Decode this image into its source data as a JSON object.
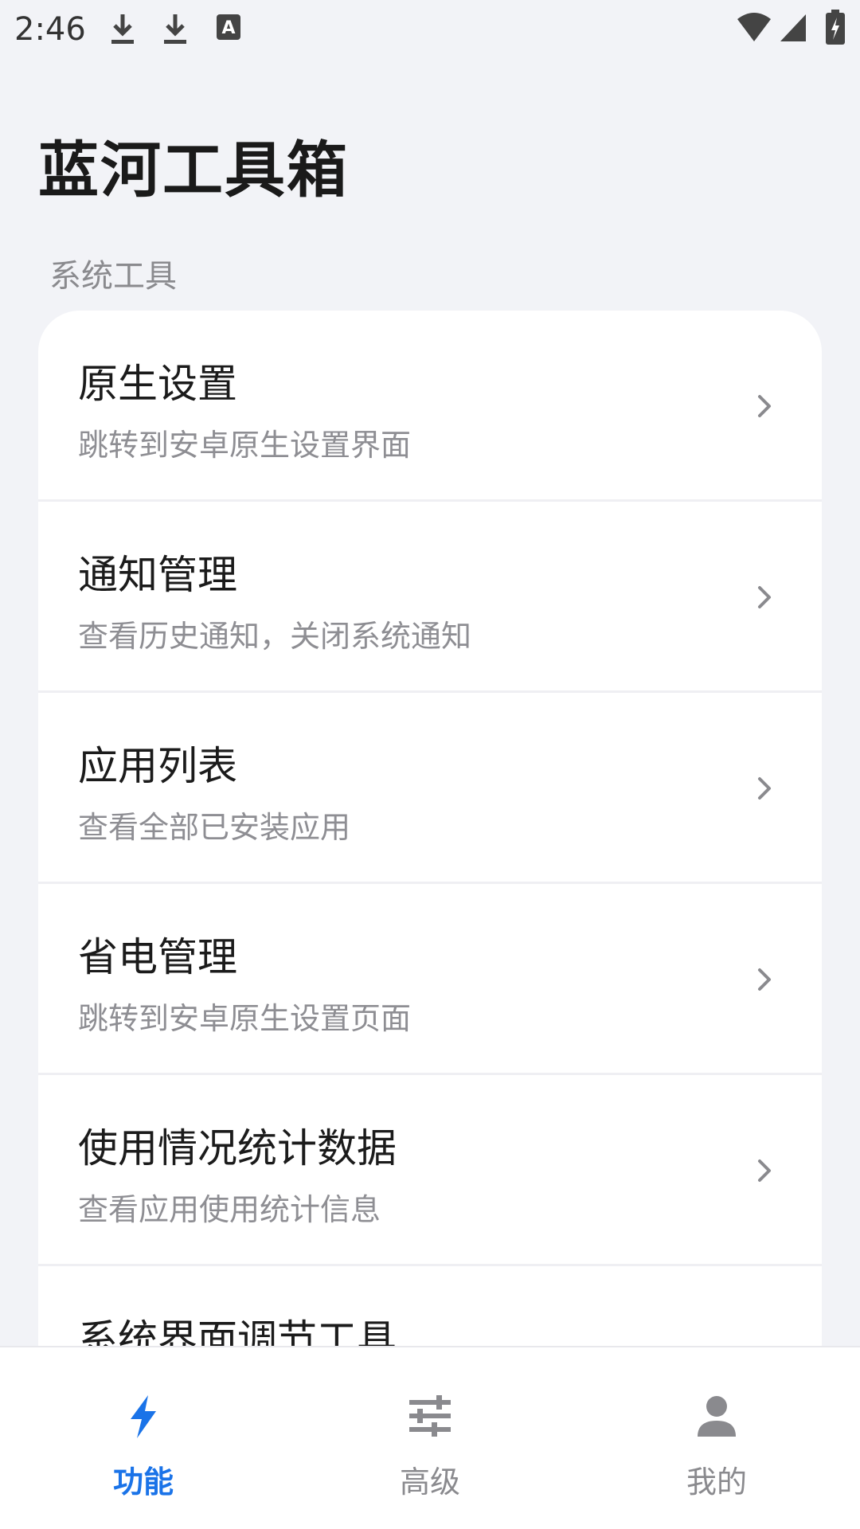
{
  "status_bar": {
    "time": "2:46",
    "icons": [
      "download-icon",
      "download-icon",
      "accessibility-a-icon",
      "wifi-icon",
      "signal-icon",
      "battery-charging-icon"
    ]
  },
  "header": {
    "title": "蓝河工具箱"
  },
  "section": {
    "label": "系统工具"
  },
  "list": {
    "items": [
      {
        "title": "原生设置",
        "subtitle": "跳转到安卓原生设置界面"
      },
      {
        "title": "通知管理",
        "subtitle": "查看历史通知，关闭系统通知"
      },
      {
        "title": "应用列表",
        "subtitle": "查看全部已安装应用"
      },
      {
        "title": "省电管理",
        "subtitle": "跳转到安卓原生设置页面"
      },
      {
        "title": "使用情况统计数据",
        "subtitle": "查看应用使用统计信息"
      },
      {
        "title": "系统界面调节工具",
        "subtitle": ""
      }
    ]
  },
  "bottom_nav": {
    "tabs": [
      {
        "label": "功能",
        "icon": "bolt-icon",
        "active": true
      },
      {
        "label": "高级",
        "icon": "sliders-icon",
        "active": false
      },
      {
        "label": "我的",
        "icon": "person-icon",
        "active": false
      }
    ]
  },
  "colors": {
    "accent": "#1a73e8",
    "background": "#f2f3f7",
    "inactive": "#8a8a8e"
  }
}
